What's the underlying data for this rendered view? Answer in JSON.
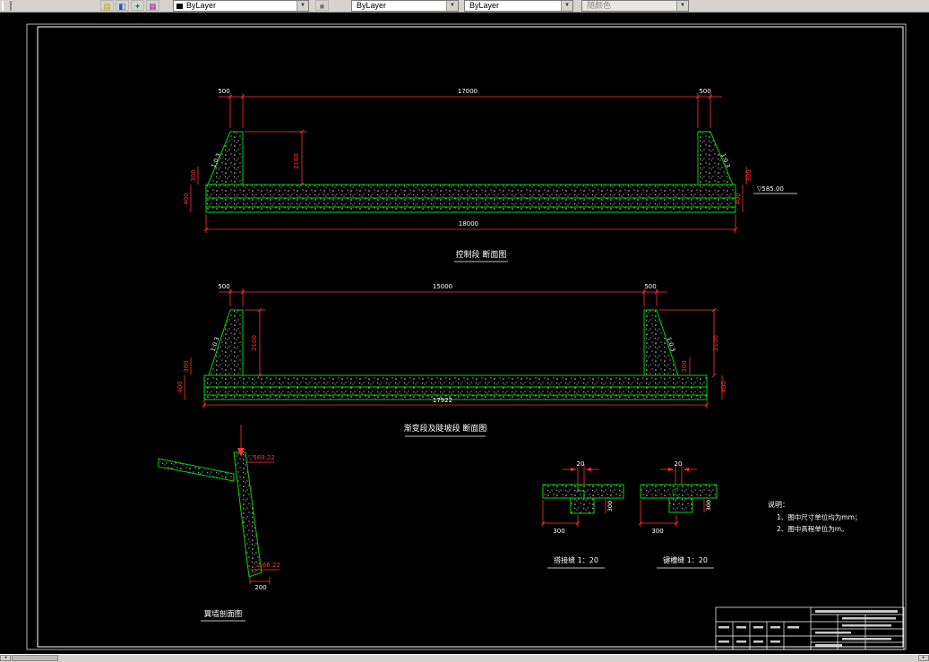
{
  "toolbar": {
    "combos": [
      {
        "label": "ByLayer"
      },
      {
        "label": "ByLayer"
      },
      {
        "label": "ByLayer"
      },
      {
        "label": "随颜色"
      }
    ]
  },
  "sections": {
    "s1": {
      "title": "控制段 断面图",
      "dim_top_left": "500",
      "dim_top_mid": "17000",
      "dim_top_right": "500",
      "dim_bottom": "18000",
      "dim_wall_height": "2100",
      "dim_left_300": "300",
      "dim_left_400": "400",
      "dim_right_300": "300",
      "dim_right_400": "400",
      "slope_left": "1:0.3",
      "slope_right": "1:0.3",
      "elevation": "▽585.00"
    },
    "s2": {
      "title": "渐变段及陡坡段 断面图",
      "dim_top_left": "500",
      "dim_top_mid": "15000",
      "dim_top_right": "500",
      "dim_bottom": "17922",
      "dim_wall_height_left": "2100",
      "dim_wall_height_right": "2100",
      "dim_left_300": "300",
      "dim_left_400": "400",
      "dim_right_300": "300",
      "dim_right_400": "400",
      "slope_left": "1:0.3",
      "slope_right": "1:0.3"
    },
    "s3": {
      "title": "翼墙剖面图",
      "elev_top": "▽569.22",
      "elev_bottom": "▽566.22",
      "dim_200": "200"
    },
    "j1": {
      "title": "搭接缝 1：20",
      "dim_20": "20",
      "dim_300": "300",
      "dim_300v": "300"
    },
    "j2": {
      "title": "键槽缝 1：20",
      "dim_20": "20",
      "dim_300": "300",
      "dim_300v": "300"
    }
  },
  "notes": {
    "heading": "说明：",
    "line1": "1、图中尺寸单位均为mm；",
    "line2": "2、图中高程单位为m。"
  }
}
